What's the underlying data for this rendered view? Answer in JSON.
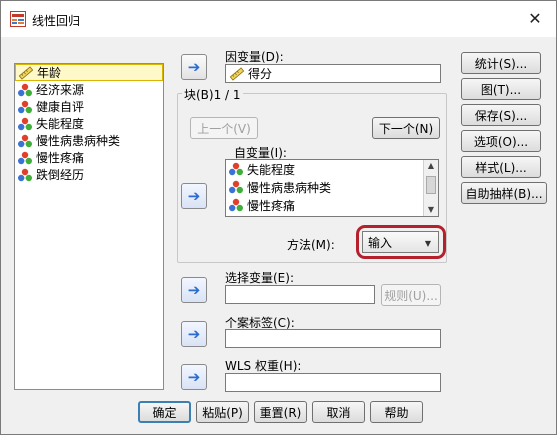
{
  "window": {
    "title": "线性回归"
  },
  "variables": [
    {
      "name": "年龄",
      "icon": "scale-ruler-icon",
      "selected": true
    },
    {
      "name": "经济来源",
      "icon": "nominal-balls-icon"
    },
    {
      "name": "健康自评",
      "icon": "nominal-balls-icon"
    },
    {
      "name": "失能程度",
      "icon": "nominal-balls-icon"
    },
    {
      "name": "慢性病患病种类",
      "icon": "nominal-balls-icon"
    },
    {
      "name": "慢性疼痛",
      "icon": "nominal-balls-icon"
    },
    {
      "name": "跌倒经历",
      "icon": "nominal-balls-icon"
    }
  ],
  "dependent": {
    "label": "因变量(D):",
    "value": "得分",
    "icon": "scale-ruler-icon"
  },
  "block": {
    "label": "块(B)1 / 1",
    "prev_label": "上一个(V)",
    "next_label": "下一个(N)"
  },
  "independent": {
    "label": "自变量(I):",
    "items": [
      {
        "name": "失能程度",
        "icon": "nominal-balls-icon"
      },
      {
        "name": "慢性病患病种类",
        "icon": "nominal-balls-icon"
      },
      {
        "name": "慢性疼痛",
        "icon": "nominal-balls-icon"
      }
    ]
  },
  "method": {
    "label": "方法(M):",
    "value": "输入"
  },
  "selection_var": {
    "label": "选择变量(E):",
    "value": "",
    "rule_label": "规则(U)..."
  },
  "case_label": {
    "label": "个案标签(C):",
    "value": ""
  },
  "wls": {
    "label": "WLS 权重(H):",
    "value": ""
  },
  "side_buttons": [
    "统计(S)...",
    "图(T)...",
    "保存(S)...",
    "选项(O)...",
    "样式(L)...",
    "自助抽样(B)..."
  ],
  "bottom_buttons": {
    "ok": "确定",
    "paste": "粘贴(P)",
    "reset": "重置(R)",
    "cancel": "取消",
    "help": "帮助"
  },
  "colors": {
    "highlight_ring": "#b4202c",
    "arrow": "#2a6ccf"
  }
}
